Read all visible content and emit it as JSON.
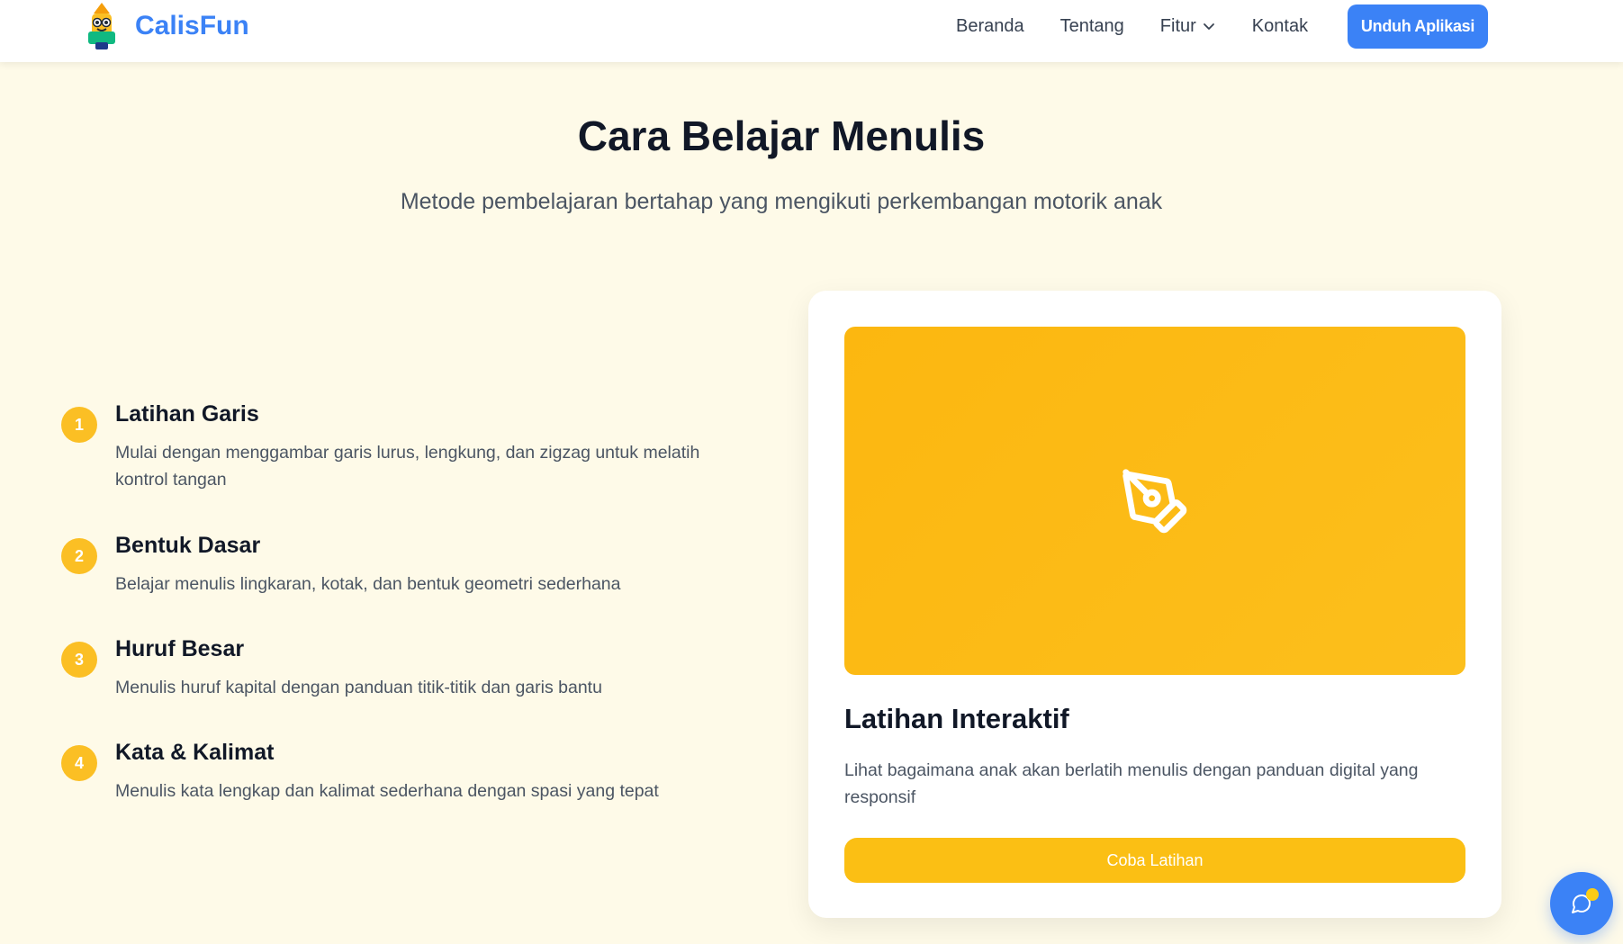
{
  "colors": {
    "primary": "#3b82f6",
    "accent": "#fbbf24",
    "background": "#fefae8"
  },
  "navbar": {
    "brand": "CalisFun",
    "logo_icon": "pencil-mascot-icon",
    "links": [
      {
        "label": "Beranda"
      },
      {
        "label": "Tentang"
      },
      {
        "label": "Fitur",
        "has_dropdown": true
      },
      {
        "label": "Kontak"
      }
    ],
    "cta_label": "Unduh Aplikasi"
  },
  "section": {
    "title": "Cara Belajar Menulis",
    "subtitle": "Metode pembelajaran bertahap yang mengikuti perkembangan motorik anak"
  },
  "steps": [
    {
      "number": "1",
      "title": "Latihan Garis",
      "description": "Mulai dengan menggambar garis lurus, lengkung, dan zigzag untuk melatih kontrol tangan"
    },
    {
      "number": "2",
      "title": "Bentuk Dasar",
      "description": "Belajar menulis lingkaran, kotak, dan bentuk geometri sederhana"
    },
    {
      "number": "3",
      "title": "Huruf Besar",
      "description": "Menulis huruf kapital dengan panduan titik-titik dan garis bantu"
    },
    {
      "number": "4",
      "title": "Kata & Kalimat",
      "description": "Menulis kata lengkap dan kalimat sederhana dengan spasi yang tepat"
    }
  ],
  "card": {
    "icon": "pen-tool-icon",
    "title": "Latihan Interaktif",
    "description": "Lihat bagaimana anak akan berlatih menulis dengan panduan digital yang responsif",
    "button_label": "Coba Latihan"
  },
  "fab": {
    "icon": "chat-bubble-icon"
  }
}
